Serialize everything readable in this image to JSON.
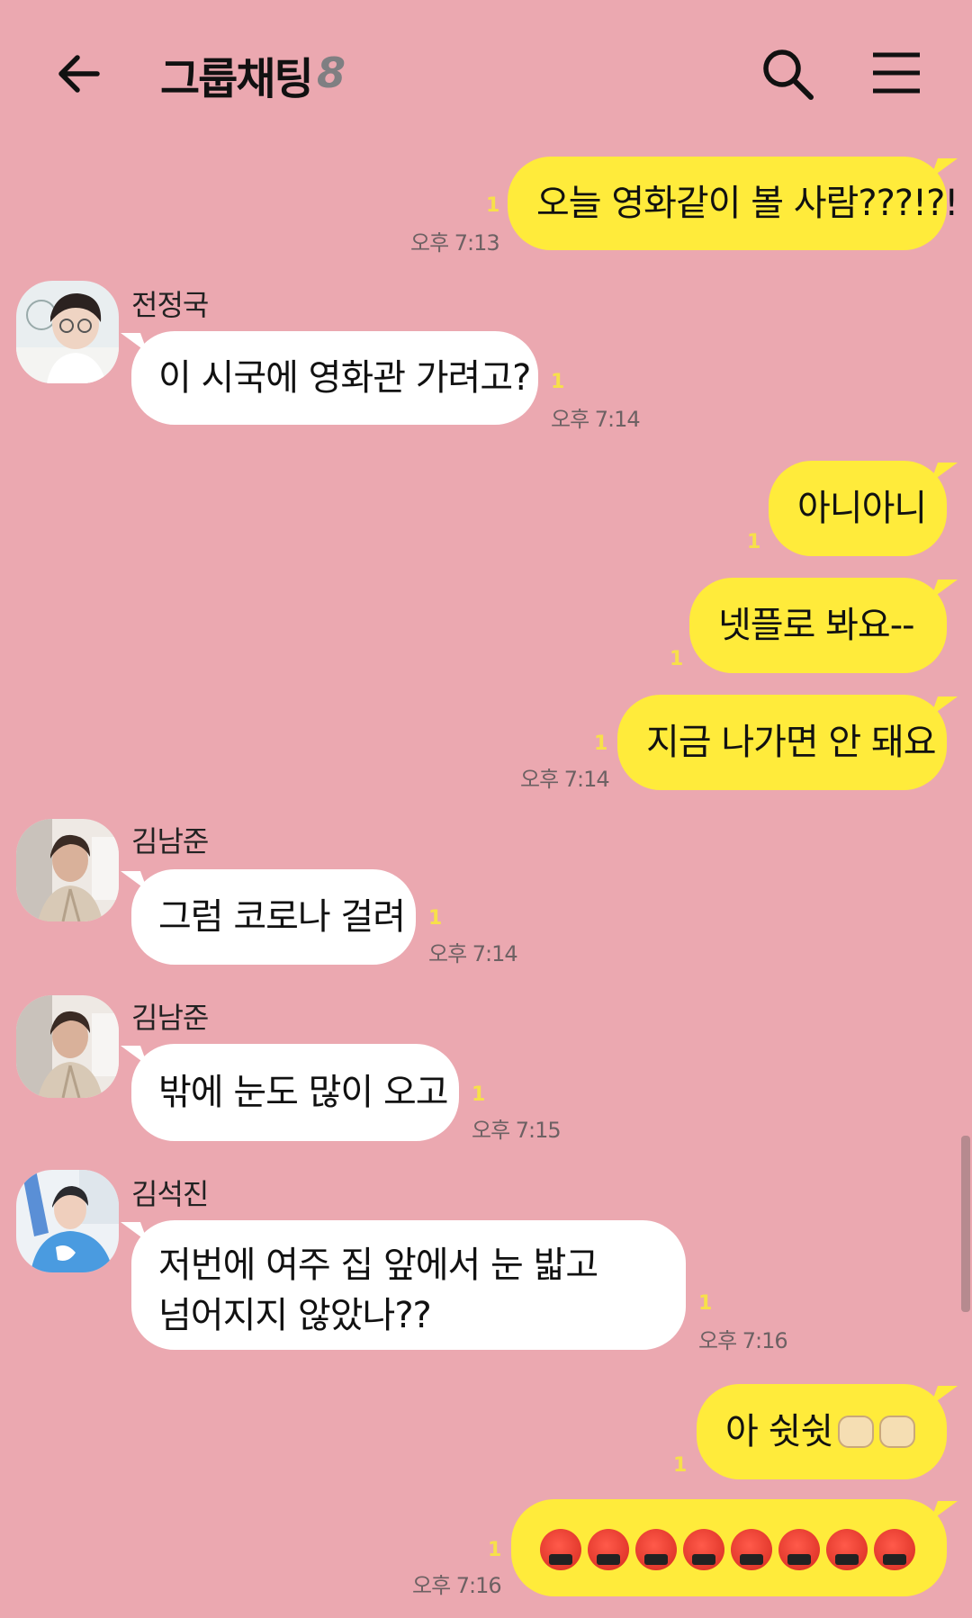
{
  "header": {
    "title": "그룹채팅",
    "member_count": "8"
  },
  "messages": [
    {
      "text": "오늘 영화같이 볼 사람???!?!",
      "unread": "1",
      "time": "오후 7:13"
    },
    {
      "sender": "전정국",
      "text": "이 시국에 영화관 가려고?",
      "unread": "1",
      "time": "오후 7:14"
    },
    {
      "text": "아니아니",
      "unread": "1"
    },
    {
      "text": "넷플로 봐요--",
      "unread": "1"
    },
    {
      "text": "지금 나가면 안 돼요",
      "unread": "1",
      "time": "오후 7:14"
    },
    {
      "sender": "김남준",
      "text": "그럼 코로나 걸려",
      "unread": "1",
      "time": "오후 7:14"
    },
    {
      "sender": "김남준",
      "text": "밖에 눈도 많이 오고",
      "unread": "1",
      "time": "오후 7:15"
    },
    {
      "sender": "김석진",
      "line1": "저번에 여주 집 앞에서 눈 밟고",
      "line2": "넘어지지 않았나??",
      "unread": "1",
      "time": "오후 7:16"
    },
    {
      "text": "아 쉿쉿",
      "emoji": "fist-icon",
      "unread": "1"
    },
    {
      "emoji": "angry-cursing-face-icon",
      "emoji_count": 8,
      "unread": "1",
      "time": "오후 7:16"
    }
  ],
  "colors": {
    "background": "#eba8b0",
    "my_bubble": "#ffeb3b",
    "their_bubble": "#ffffff",
    "unread": "#f7e04a"
  }
}
